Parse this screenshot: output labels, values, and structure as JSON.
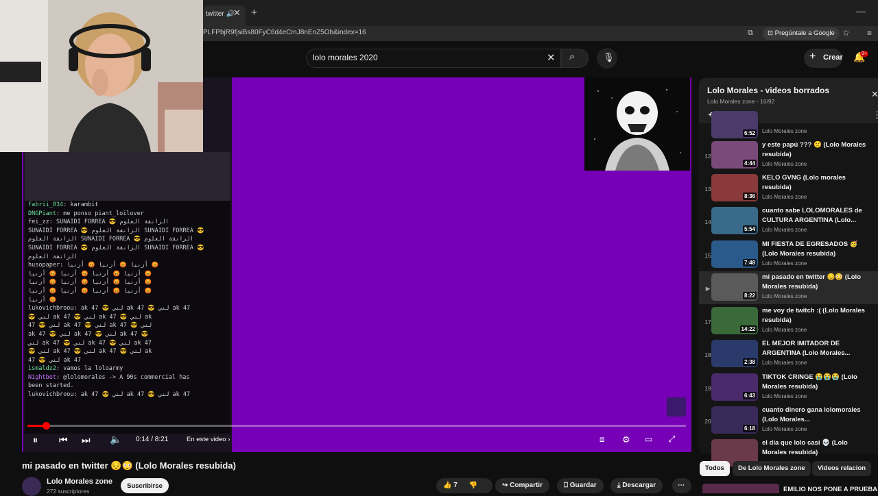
{
  "browser": {
    "tab_title": "twitter",
    "url": "PLFPbjR9fjsiBs80FyC6d4eCmJ8nEnZ5Ob&index=16",
    "google_button": "Pregúntale a Google"
  },
  "header": {
    "search_query": "lolo morales 2020",
    "create_label": "Crear",
    "notifications": "9+"
  },
  "chat": [
    {
      "user": "fabrii_834",
      "msg": "karambit",
      "color": "#6fe0a0"
    },
    {
      "user": "DNGPiant",
      "msg": "me ponso piant_loilover",
      "color": "#6fe0a0"
    },
    {
      "user": "fei_zz",
      "msg": "SUNAIDI FORREA 😎 الزانقة العلوم",
      "color": "#d0d0d0"
    },
    {
      "user": "",
      "msg": "SUNAIDI FORREA 😎 الزانقة العلوم SUNAIDI FORREA 😎",
      "color": "#d0d0d0"
    },
    {
      "user": "",
      "msg": "الزانقة العلوم SUNAIDI FORREA 😎 الزانقة العلوم",
      "color": "#d0d0d0"
    },
    {
      "user": "",
      "msg": "SUNAIDI FORREA 😎 الزانقة العلوم SUNAIDI FORREA 😎",
      "color": "#d0d0d0"
    },
    {
      "user": "",
      "msg": "الزانقة العلوم",
      "color": "#d0d0d0"
    },
    {
      "user": "husopaper",
      "msg": "أزنيا 😡 أزنيا 😡 أزنيا 😡",
      "color": "#d0d0d0"
    },
    {
      "user": "",
      "msg": "أزنيا 😡 أزنيا 😡 أزنيا 😡 أزنيا 😡",
      "color": "#d0d0d0"
    },
    {
      "user": "",
      "msg": "أزنيا 😡 أزنيا 😡 أزنيا 😡 أزنيا 😡",
      "color": "#d0d0d0"
    },
    {
      "user": "",
      "msg": "أزنيا 😡 أزنيا 😡 أزنيا 😡 أزنيا 😡",
      "color": "#d0d0d0"
    },
    {
      "user": "",
      "msg": "أزنيا 😡",
      "color": "#d0d0d0"
    },
    {
      "user": "lukovichbroou",
      "msg": "ak 47 😎 لني ak 47 😎 لني ak 47",
      "color": "#d0d0d0"
    },
    {
      "user": "",
      "msg": "😎 لني ak 47 😎 لني ak 47 😎 لني ak",
      "color": "#d0d0d0"
    },
    {
      "user": "",
      "msg": "47 😎 لني ak 47 😎 لني ak 47 😎 لني",
      "color": "#d0d0d0"
    },
    {
      "user": "",
      "msg": "ak 47 😎 لني ak 47 😎 لني ak 47 😎",
      "color": "#d0d0d0"
    },
    {
      "user": "",
      "msg": "لني ak 47 😎 لني ak 47 😎 لني ak 47",
      "color": "#d0d0d0"
    },
    {
      "user": "",
      "msg": "😎 لني ak 47 😎 لني ak 47 😎 لني ak",
      "color": "#d0d0d0"
    },
    {
      "user": "",
      "msg": "47 😎 لني ak 47",
      "color": "#d0d0d0"
    },
    {
      "user": "ismaldz2",
      "msg": "vamos la loloarmy",
      "color": "#6fe0a0"
    },
    {
      "user": "Nightbot",
      "msg": "@lolomorales -> A 90s commercial has",
      "color": "#c778ff"
    },
    {
      "user": "",
      "msg": "been started.",
      "color": "#d0d0d0"
    },
    {
      "user": "lukovichbroou",
      "msg": "ak 47 😎 لني ak 47 😎 لني ak 47",
      "color": "#d0d0d0"
    }
  ],
  "player": {
    "current_time": "0:14",
    "duration": "8:21",
    "time_label": "0:14 / 8:21",
    "chapter_label": "En este video",
    "progress_fraction": 0.028
  },
  "video": {
    "title": "mi pasado en twitter 😔😳 (Lolo Morales resubida)",
    "channel": "Lolo Morales zone",
    "subscribers": "272 suscriptores",
    "subscribe_label": "Suscribirse",
    "likes": "7",
    "share_label": "Compartir",
    "save_label": "Guardar",
    "download_label": "Descargar"
  },
  "playlist": {
    "title": "Lolo Morales - videos borrados",
    "subtitle": "Lolo Morales zone - 16/92",
    "items": [
      {
        "index": "",
        "title": "",
        "channel": "Lolo Morales zone",
        "duration": "6:52",
        "color": "#4b3a6a"
      },
      {
        "index": "12",
        "title": "y este papú ??? 🙂 (Lolo Morales resubida)",
        "channel": "Lolo Morales zone",
        "duration": "4:44",
        "color": "#7a4a7a"
      },
      {
        "index": "13",
        "title": "KELO GVNG (Lolo morales resubida)",
        "channel": "Lolo Morales zone",
        "duration": "8:36",
        "color": "#8a3a3a"
      },
      {
        "index": "14",
        "title": "cuanto sabe LOLOMORALES de CULTURA ARGENTINA (Lolo...",
        "channel": "Lolo Morales zone",
        "duration": "5:54",
        "color": "#3a6a8a"
      },
      {
        "index": "15",
        "title": "MI FIESTA DE EGRESADOS 🥳 (Lolo Morales resubida)",
        "channel": "Lolo Morales zone",
        "duration": "7:48",
        "color": "#2a5a8a"
      },
      {
        "index": "▶",
        "title": "mi pasado en twitter 😔😳 (Lolo Morales resubida)",
        "channel": "Lolo Morales zone",
        "duration": "8:22",
        "color": "#5a5a5a"
      },
      {
        "index": "17",
        "title": "me voy de twitch :( (Lolo Morales resubida)",
        "channel": "Lolo Morales zone",
        "duration": "14:22",
        "color": "#3a6a3a"
      },
      {
        "index": "18",
        "title": "EL MEJOR IMITADOR DE ARGENTINA (Lolo Morales...",
        "channel": "Lolo Morales zone",
        "duration": "2:38",
        "color": "#2a3a6a"
      },
      {
        "index": "19",
        "title": "TIKTOK CRINGE 😭😭😭 (Lolo Morales resubida)",
        "channel": "Lolo Morales zone",
        "duration": "6:43",
        "color": "#4a2a6a"
      },
      {
        "index": "20",
        "title": "cuanto dinero gana lolomorales (Lolo Morales...",
        "channel": "Lolo Morales zone",
        "duration": "6:18",
        "color": "#3a2a5a"
      },
      {
        "index": "",
        "title": "el dia que lolo casi 💀 (Lolo Morales resubida)",
        "channel": "",
        "duration": "",
        "color": "#6a3a4a"
      }
    ]
  },
  "chips": [
    "Todos",
    "De Lolo Morales zone",
    "Videos relacion"
  ],
  "next_video": "EMILIO NOS PONE A PRUEBA |"
}
